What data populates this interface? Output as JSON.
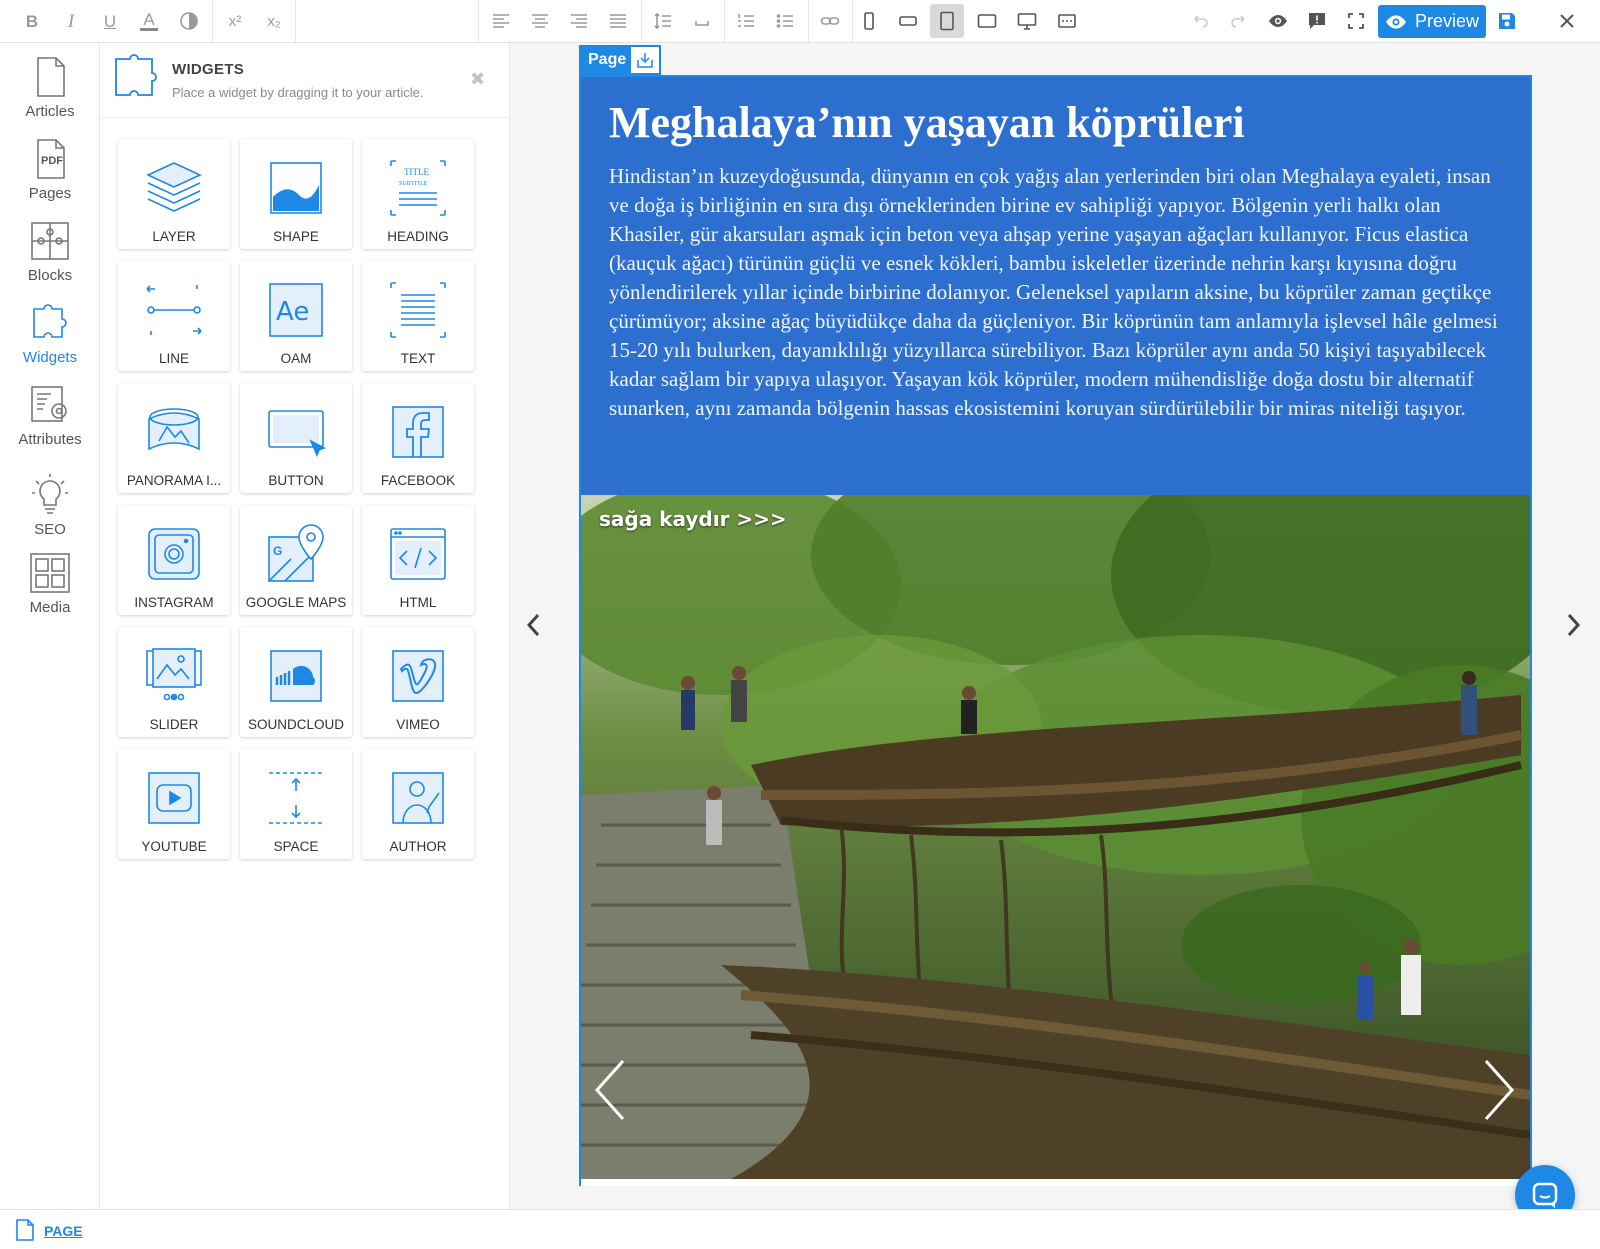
{
  "toolbar": {
    "bold": "B",
    "italic": "I",
    "underline": "U",
    "text_color": "A",
    "superscript": "x²",
    "subscript": "x₂",
    "preview_label": "Preview",
    "icons": [
      "bold-icon",
      "italic-icon",
      "underline-icon",
      "text-color-icon",
      "background-color-icon",
      "superscript-icon",
      "subscript-icon",
      "align-left-icon",
      "align-center-icon",
      "align-right-icon",
      "align-justify-icon",
      "line-height-icon",
      "letter-spacing-icon",
      "ordered-list-icon",
      "unordered-list-icon",
      "link-icon",
      "mobile-portrait-icon",
      "mobile-landscape-icon",
      "tablet-portrait-icon",
      "tablet-landscape-icon",
      "desktop-icon",
      "custom-device-icon",
      "undo-icon",
      "redo-icon",
      "eye-icon",
      "feedback-icon",
      "fullscreen-icon",
      "save-icon",
      "close-icon"
    ]
  },
  "rail": {
    "items": [
      {
        "label": "Articles",
        "icon": "document-icon"
      },
      {
        "label": "Pages",
        "icon": "pdf-icon"
      },
      {
        "label": "Blocks",
        "icon": "puzzle-icon"
      },
      {
        "label": "Widgets",
        "icon": "widget-puzzle-icon",
        "active": true
      },
      {
        "label": "Attributes",
        "icon": "attributes-gear-icon"
      },
      {
        "label": "SEO",
        "icon": "lightbulb-icon"
      },
      {
        "label": "Media",
        "icon": "media-grid-icon"
      }
    ]
  },
  "widgets_panel": {
    "title": "WIDGETS",
    "subtitle": "Place a widget by dragging it to your article.",
    "close": "✖",
    "tiles": [
      {
        "label": "LAYER",
        "icon": "layers-icon"
      },
      {
        "label": "SHAPE",
        "icon": "shape-icon"
      },
      {
        "label": "HEADING",
        "icon": "heading-icon",
        "icon_text_1": "TITLE",
        "icon_text_2": "SUBTITLE"
      },
      {
        "label": "LINE",
        "icon": "line-icon"
      },
      {
        "label": "OAM",
        "icon": "oam-icon",
        "icon_text": "Ae"
      },
      {
        "label": "TEXT",
        "icon": "text-icon"
      },
      {
        "label": "PANORAMA I...",
        "icon": "panorama-icon"
      },
      {
        "label": "BUTTON",
        "icon": "button-icon"
      },
      {
        "label": "FACEBOOK",
        "icon": "facebook-icon"
      },
      {
        "label": "INSTAGRAM",
        "icon": "instagram-icon"
      },
      {
        "label": "GOOGLE MAPS",
        "icon": "google-maps-icon"
      },
      {
        "label": "HTML",
        "icon": "html-code-icon"
      },
      {
        "label": "SLIDER",
        "icon": "slider-icon"
      },
      {
        "label": "SOUNDCLOUD",
        "icon": "soundcloud-icon"
      },
      {
        "label": "VIMEO",
        "icon": "vimeo-icon"
      },
      {
        "label": "YOUTUBE",
        "icon": "youtube-icon"
      },
      {
        "label": "SPACE",
        "icon": "space-icon"
      },
      {
        "label": "AUTHOR",
        "icon": "author-icon"
      }
    ]
  },
  "canvas": {
    "page_tab": "Page",
    "headline": "Meghalaya’nın yaşayan köprüleri",
    "body": "Hindistan’ın kuzeydoğusunda, dünyanın en çok yağış alan yerlerinden biri olan Meghalaya eyaleti, insan ve doğa iş birliğinin en sıra dışı örneklerinden birine ev sahipliği yapıyor. Bölgenin yerli halkı olan Khasiler, gür akarsuları aşmak için beton veya ahşap yerine yaşayan ağaçları kullanıyor. Ficus elastica (kauçuk ağacı) türünün güçlü ve esnek kökleri, bambu iskeletler üzerinde nehrin karşı kıyısına doğru yönlendirilerek yıllar içinde birbirine dolanıyor. Geleneksel yapıların aksine, bu köprüler zaman geçtikçe çürümüyor; aksine ağaç büyüdükçe daha da güçleniyor. Bir köprünün tam anlamıyla işlevsel hâle gelmesi 15-20 yılı bulurken, dayanıklılığı yüzyıllarca sürebiliyor. Bazı köprüler aynı anda 50 kişiyi taşıyabilecek kadar sağlam bir yapıya ulaşıyor. Yaşayan kök köprüler, modern mühendisliğe doğa dostu bir alternatif sunarken, aynı zamanda bölgenin hassas ekosistemini koruyan sürdürülebilir bir miras niteliği taşıyor.",
    "slider_hint": "sağa kaydır >>>",
    "photo_alt": "living-root-bridge-photo"
  },
  "bottombar": {
    "link": "PAGE"
  },
  "colors": {
    "accent": "#1e88e5",
    "headline_block": "#2d6fcf"
  }
}
